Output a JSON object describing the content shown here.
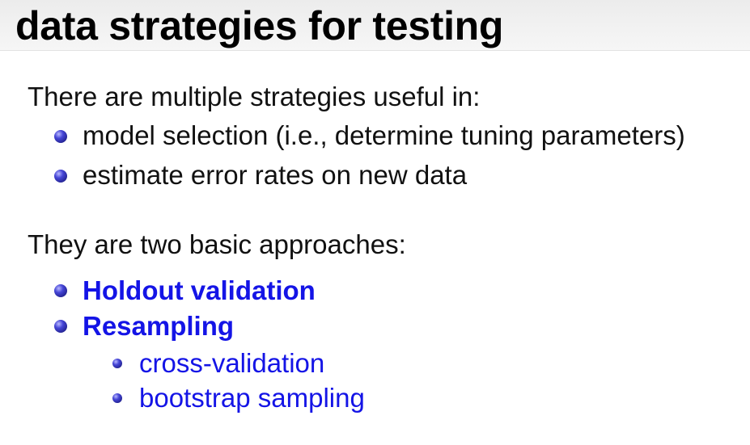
{
  "slide": {
    "title": "data strategies for testing",
    "intro": "There are multiple strategies useful in:",
    "uses": [
      "model selection (i.e., determine tuning parameters)",
      "estimate error rates on new data"
    ],
    "approaches_intro": "They are two basic approaches:",
    "approaches": [
      "Holdout validation",
      "Resampling"
    ],
    "resampling_methods": [
      "cross-validation",
      "bootstrap sampling"
    ]
  },
  "colors": {
    "highlight": "#1414e6",
    "bullet": "#2a2aa8",
    "title_bar": "#efefef"
  }
}
